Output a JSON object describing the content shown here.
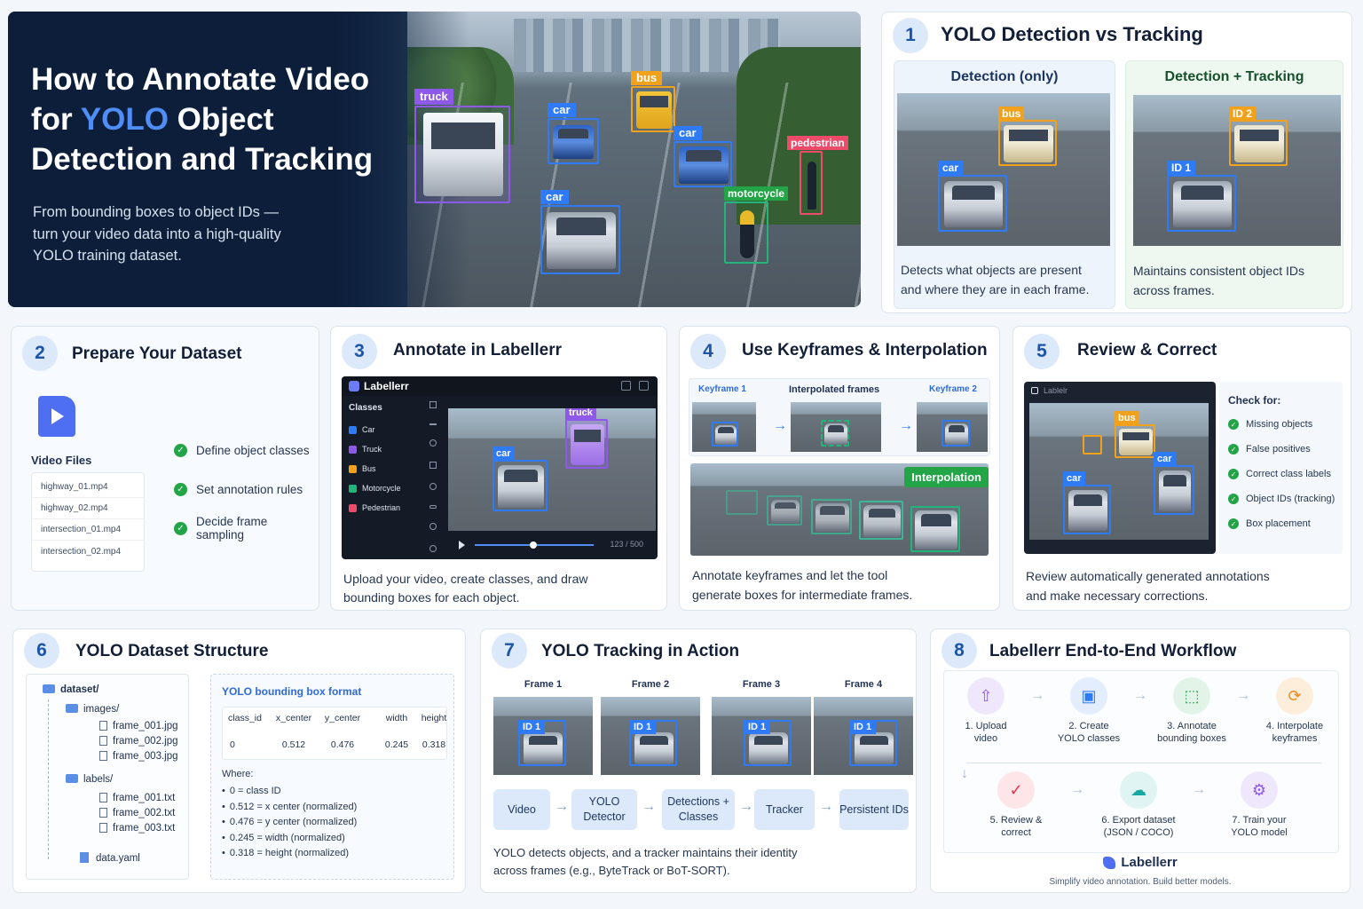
{
  "hero": {
    "title_line1": "How to Annotate Video",
    "title_for": "for ",
    "title_yolo": "YOLO",
    "title_object": " Object",
    "title_line3": "Detection and Tracking",
    "subtitle_line1": "From bounding boxes to object IDs —",
    "subtitle_line2": "turn your video data into a high-quality",
    "subtitle_line3": "YOLO training dataset.",
    "labels": {
      "truck": "truck",
      "car1": "car",
      "bus": "bus",
      "car2": "car",
      "car3": "car",
      "pedestrian": "pedestrian",
      "motorcycle": "motorcycle"
    }
  },
  "s1": {
    "num": "1",
    "title": "YOLO Detection vs Tracking",
    "left_head": "Detection (only)",
    "right_head": "Detection + Tracking",
    "left_tag_bus": "bus",
    "left_tag_car": "car",
    "right_tag_bus": "ID 2",
    "right_tag_car": "ID 1",
    "left_desc_1": "Detects what objects are present",
    "left_desc_2": "and where they are in each frame.",
    "right_desc_1": "Maintains consistent object IDs",
    "right_desc_2": "across frames."
  },
  "s2": {
    "num": "2",
    "title": "Prepare Your Dataset",
    "folder_label": "Video Files",
    "files": [
      "highway_01.mp4",
      "highway_02.mp4",
      "intersection_01.mp4",
      "intersection_02.mp4"
    ],
    "steps": [
      "Define object classes",
      "Set annotation rules",
      "Decide frame sampling"
    ]
  },
  "s3": {
    "num": "3",
    "title": "Annotate in Labellerr",
    "app_name": "Labellerr",
    "classes_head": "Classes",
    "classes": [
      {
        "name": "Car",
        "color": "#2f7bf5"
      },
      {
        "name": "Truck",
        "color": "#8e59e8"
      },
      {
        "name": "Bus",
        "color": "#f2a11d"
      },
      {
        "name": "Motorcycle",
        "color": "#22b57a"
      },
      {
        "name": "Pedestrian",
        "color": "#ee4b6a"
      }
    ],
    "tag_truck": "truck",
    "tag_car": "car",
    "frame_counter": "123 / 500",
    "desc_1": "Upload your video, create classes, and draw",
    "desc_2": "bounding boxes for each object."
  },
  "s4": {
    "num": "4",
    "title": "Use Keyframes & Interpolation",
    "kf1": "Keyframe 1",
    "interp": "Interpolated frames",
    "kf2": "Keyframe 2",
    "badge": "Interpolation",
    "desc_1": "Annotate keyframes and let the tool",
    "desc_2": "generate boxes for intermediate frames."
  },
  "s5": {
    "num": "5",
    "title": "Review & Correct",
    "app_name": "Lablelr",
    "check_head": "Check for:",
    "checks": [
      "Missing objects",
      "False positives",
      "Correct class labels",
      "Object IDs (tracking)",
      "Box placement"
    ],
    "tag_bus": "bus",
    "tag_car1": "car",
    "tag_car2": "car",
    "desc_1": "Review automatically generated annotations",
    "desc_2": "and make necessary corrections."
  },
  "s6": {
    "num": "6",
    "title": "YOLO Dataset Structure",
    "tree": {
      "root": "dataset/",
      "images": "images/",
      "img_files": [
        "frame_001.jpg",
        "frame_002.jpg",
        "frame_003.jpg"
      ],
      "labels": "labels/",
      "lbl_files": [
        "frame_001.txt",
        "frame_002.txt",
        "frame_003.txt"
      ],
      "yaml": "data.yaml"
    },
    "format_title": "YOLO bounding box format",
    "headers": [
      "class_id",
      "x_center",
      "y_center",
      "width",
      "height"
    ],
    "values": [
      "0",
      "0.512",
      "0.476",
      "0.245",
      "0.318"
    ],
    "where": "Where:",
    "legend": [
      "0  =  class ID",
      "0.512  =  x center (normalized)",
      "0.476  =  y center (normalized)",
      "0.245  =  width (normalized)",
      "0.318  =  height (normalized)"
    ]
  },
  "s7": {
    "num": "7",
    "title": "YOLO Tracking in Action",
    "frames": [
      "Frame 1",
      "Frame 2",
      "Frame 3",
      "Frame 4"
    ],
    "id_tag": "ID 1",
    "pipeline": [
      "Video",
      "YOLO Detector",
      "Detections + Classes",
      "Tracker",
      "Persistent IDs"
    ],
    "desc_1": "YOLO detects objects, and a tracker maintains their identity",
    "desc_2": "across frames (e.g., ByteTrack or BoT-SORT)."
  },
  "s8": {
    "num": "8",
    "title": "Labellerr End-to-End Workflow",
    "steps_top": [
      {
        "l1": "1. Upload",
        "l2": "video",
        "icon": "upload-icon",
        "color": "#8e59e8",
        "bg": "#efe8fc"
      },
      {
        "l1": "2. Create",
        "l2": "YOLO classes",
        "icon": "classes-icon",
        "color": "#2f7bf5",
        "bg": "#e3edfd"
      },
      {
        "l1": "3. Annotate",
        "l2": "bounding boxes",
        "icon": "annotate-icon",
        "color": "#22a447",
        "bg": "#e2f4e8"
      },
      {
        "l1": "4. Interpolate",
        "l2": "keyframes",
        "icon": "interpolate-icon",
        "color": "#f08a1d",
        "bg": "#fdeedc"
      }
    ],
    "steps_bottom": [
      {
        "l1": "5. Review &",
        "l2": "correct",
        "icon": "review-icon",
        "color": "#e8354f",
        "bg": "#fde5e8"
      },
      {
        "l1": "6. Export dataset",
        "l2": "(JSON / COCO)",
        "icon": "export-icon",
        "color": "#18a6a0",
        "bg": "#dff4f3"
      },
      {
        "l1": "7. Train your",
        "l2": "YOLO model",
        "icon": "train-icon",
        "color": "#8e59e8",
        "bg": "#efe8fc"
      }
    ],
    "brand": "Labellerr",
    "tagline": "Simplify video annotation. Build better models."
  }
}
